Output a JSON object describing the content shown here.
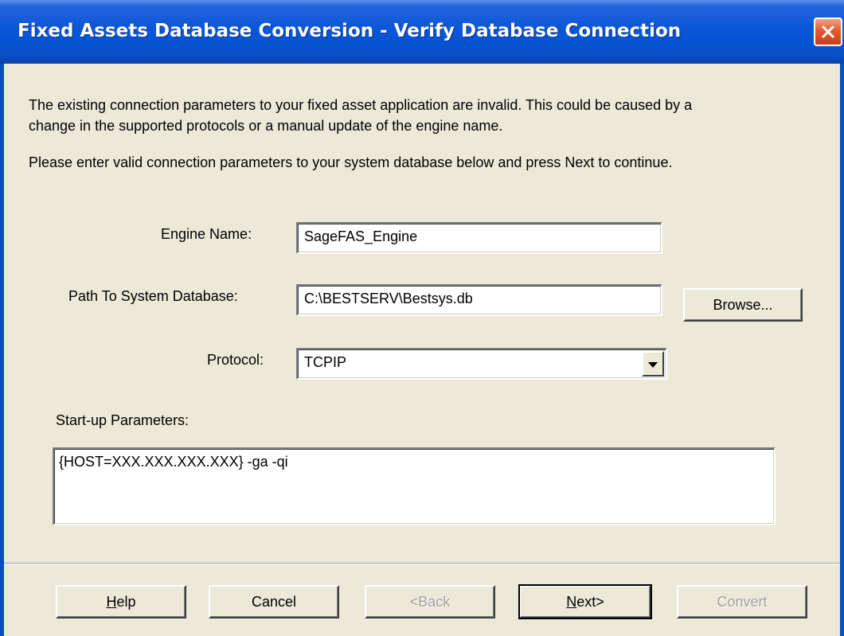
{
  "window": {
    "title": "Fixed Assets Database Conversion - Verify Database Connection"
  },
  "intro": {
    "line1": "The existing connection parameters to your fixed asset application are invalid.  This could be caused by a",
    "line2": "change in the supported protocols or a manual update of the engine name.",
    "line3": "Please enter valid connection parameters to your system database below and press Next to continue."
  },
  "form": {
    "engine_name_label": "Engine Name:",
    "engine_name_value": "SageFAS_Engine",
    "path_label": "Path To System Database:",
    "path_value": "C:\\BESTSERV\\Bestsys.db",
    "browse_label": "Browse...",
    "protocol_label": "Protocol:",
    "protocol_value": "TCPIP",
    "startup_label": "Start-up Parameters:",
    "startup_value": "{HOST=XXX.XXX.XXX.XXX} -ga -qi"
  },
  "buttons": {
    "help": "Help",
    "help_access_key": "H",
    "help_rest": "elp",
    "cancel": "Cancel",
    "back": "<Back",
    "next_access_key": "N",
    "next_rest": "ext>",
    "convert": "Convert"
  },
  "icons": {
    "close": "close-icon",
    "dropdown": "chevron-down-icon"
  }
}
